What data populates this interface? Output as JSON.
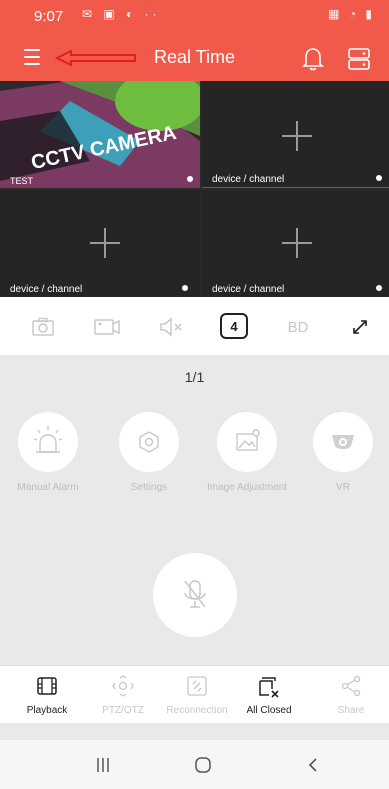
{
  "status": {
    "time": "9:07"
  },
  "header": {
    "title": "Real Time"
  },
  "grid": {
    "cells": [
      {
        "label": "TEST",
        "overlay": "CCTV CAMERA"
      },
      {
        "label": "device / channel"
      },
      {
        "label": "device / channel"
      },
      {
        "label": "device / channel"
      }
    ]
  },
  "toolbar": {
    "split_value": "4",
    "bd_label": "BD"
  },
  "main": {
    "page_indicator": "1/1",
    "controls": [
      {
        "label": "Manual Alarm",
        "icon": "alarm-light-icon"
      },
      {
        "label": "Settings",
        "icon": "settings-icon"
      },
      {
        "label": "Image Adjustment",
        "icon": "image-adjust-icon"
      },
      {
        "label": "VR",
        "icon": "dome-camera-icon"
      }
    ]
  },
  "bottom": {
    "items": [
      {
        "label": "Playback",
        "enabled": true,
        "icon": "film-icon"
      },
      {
        "label": "PTZ/OTZ",
        "enabled": false,
        "icon": "ptz-icon"
      },
      {
        "label": "Reconnection",
        "enabled": false,
        "icon": "reconnect-icon"
      },
      {
        "label": "All Closed",
        "enabled": true,
        "icon": "close-all-icon"
      },
      {
        "label": "Share",
        "enabled": false,
        "icon": "share-icon"
      }
    ]
  },
  "colors": {
    "accent": "#f15a4a",
    "disabled": "#c8c8c8",
    "annotation_arrow": "#e0201e"
  }
}
